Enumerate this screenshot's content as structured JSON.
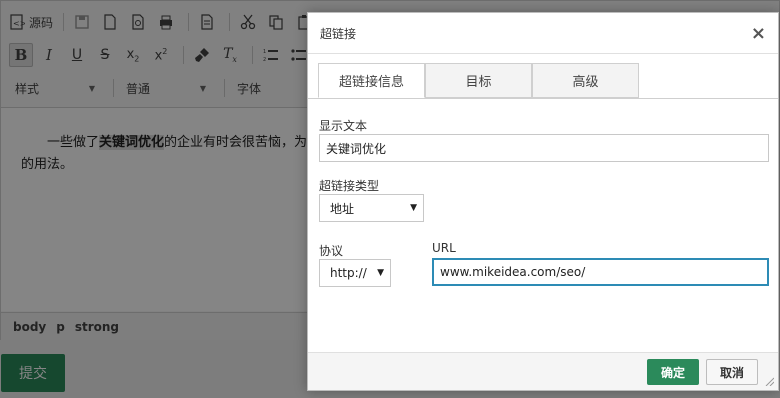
{
  "editor": {
    "toolbar": {
      "source_label": "源码",
      "style_combo": "样式",
      "format_combo": "普通",
      "font_combo": "字体"
    },
    "content": {
      "text_before": "一些做了",
      "bold_text": "关键词优化",
      "text_after": "的企业有时会很苦恼，为",
      "line2": "的用法。"
    },
    "statusbar": {
      "path": [
        "body",
        "p",
        "strong"
      ]
    },
    "submit_label": "提交"
  },
  "dialog": {
    "title": "超链接",
    "close_glyph": "×",
    "tabs": [
      {
        "label": "超链接信息",
        "active": true
      },
      {
        "label": "目标",
        "active": false
      },
      {
        "label": "高级",
        "active": false
      }
    ],
    "display_text_label": "显示文本",
    "display_text_value": "关键词优化",
    "link_type_label": "超链接类型",
    "link_type_value": "地址",
    "protocol_label": "协议",
    "protocol_value": "http://",
    "url_label": "URL",
    "url_value": "www.mikeidea.com/seo/",
    "ok_label": "确定",
    "cancel_label": "取消"
  },
  "colors": {
    "accent_green": "#2b8a5b",
    "focus_blue": "#2d8bb5"
  }
}
